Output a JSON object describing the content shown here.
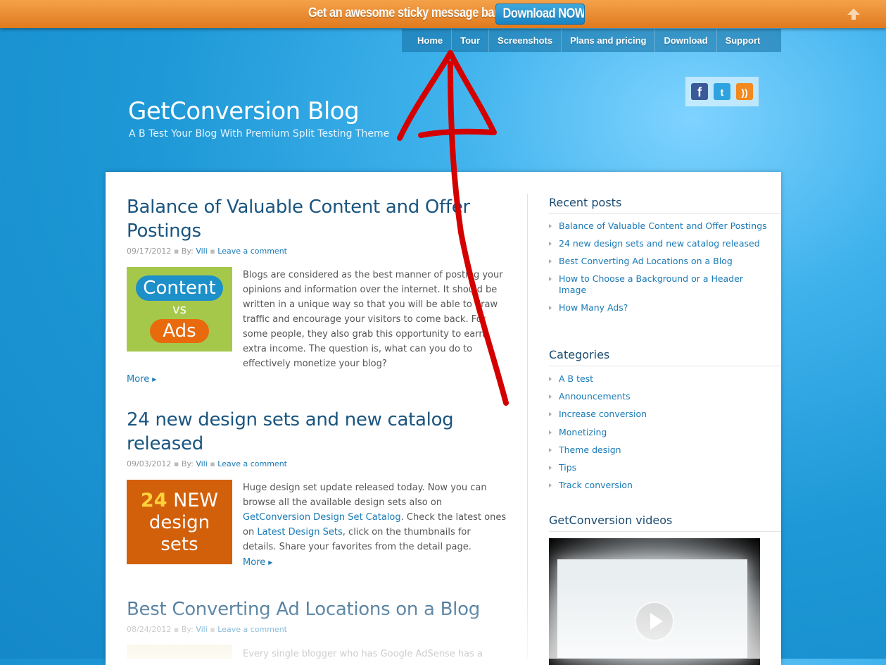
{
  "topbar": {
    "message": "Get an awesome sticky message bar!",
    "button_label": "Download NOW",
    "up_icon": "arrow-up-icon"
  },
  "nav": {
    "items": [
      "Home",
      "Tour",
      "Screenshots",
      "Plans and pricing",
      "Download",
      "Support"
    ]
  },
  "social": {
    "icons": [
      "facebook-icon",
      "twitter-icon",
      "rss-icon"
    ],
    "fb": "f",
    "tw": "t",
    "rss": "))"
  },
  "blog": {
    "title": "GetConversion Blog",
    "tagline": "A B Test Your Blog With Premium Split Testing Theme"
  },
  "posts": [
    {
      "title": "Balance of Valuable Content and Offer Postings",
      "date": "09/17/2012",
      "by_label": "By:",
      "author": "Vili",
      "comment_link": "Leave a comment",
      "thumb": {
        "top": "Content",
        "mid": "vs",
        "bottom": "Ads"
      },
      "excerpt": "Blogs are considered as the best manner of posting your opinions and information over the internet. It should be written in a unique way so that you will be able to draw traffic and encourage your visitors to come back. For some people, they also grab this opportunity to earn extra income. The question is, what can you do to effectively monetize your blog?",
      "more": "More"
    },
    {
      "title": "24 new design sets and new catalog released",
      "date": "09/03/2012",
      "by_label": "By:",
      "author": "Vili",
      "comment_link": "Leave a comment",
      "thumb": {
        "num": "24",
        "l1": "NEW",
        "l2": "design",
        "l3": "sets"
      },
      "excerpt_1": "Huge design set update released today. Now you can browse all the available design sets also on ",
      "link_1": "GetConversion Design Set Catalog",
      "excerpt_2": ". Check the latest ones on ",
      "link_2": "Latest Design Sets",
      "excerpt_3": ", click on the thumbnails for details. Share your favorites from the detail page.",
      "more": "More"
    },
    {
      "title": "Best Converting Ad Locations on a Blog",
      "date": "08/24/2012",
      "by_label": "By:",
      "author": "Vili",
      "comment_link": "Leave a comment",
      "excerpt": "Every single blogger who has Google AdSense has a"
    }
  ],
  "sidebar": {
    "recent_heading": "Recent posts",
    "recent": [
      "Balance of Valuable Content and Offer Postings",
      "24 new design sets and new catalog released",
      "Best Converting Ad Locations on a Blog",
      "How to Choose a Background or a Header Image",
      "How Many Ads?"
    ],
    "categories_heading": "Categories",
    "categories": [
      "A B test",
      "Announcements",
      "Increase conversion",
      "Monetizing",
      "Theme design",
      "Tips",
      "Track conversion"
    ],
    "videos_heading": "GetConversion videos"
  },
  "colors": {
    "topbar": "#e88a2c",
    "button": "#1d8fc9",
    "link": "#1a7ab5",
    "annotation_arrow": "#d40000"
  }
}
